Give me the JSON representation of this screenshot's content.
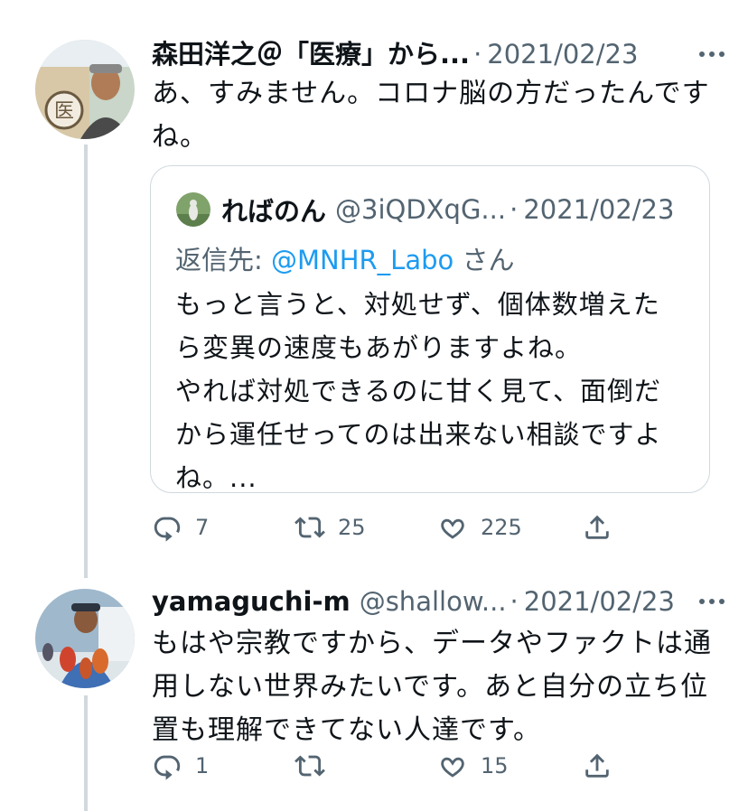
{
  "tweets": [
    {
      "name": "森田洋之＠「医療」から...",
      "separator": "·",
      "date": "2021/02/23",
      "text_lines": [
        "あ、すみません。コロナ脳の方だったんです",
        "ね。"
      ],
      "quote": {
        "name": "ればのん",
        "handle": "@3iQDXqG...",
        "separator": "·",
        "date": "2021/02/23",
        "reply_prefix": "返信先: ",
        "reply_user": "@MNHR_Labo",
        "reply_suffix": " さん",
        "text_lines": [
          "もっと言うと、対処せず、個体数増えた",
          "ら変異の速度もあがりますよね。",
          "やれば対処できるのに甘く見て、面倒だ",
          "から運任せってのは出来ない相談ですよ",
          "ね。..."
        ]
      },
      "actions": {
        "reply_count": "7",
        "retweet_count": "25",
        "like_count": "225"
      }
    },
    {
      "name": "yamaguchi-m",
      "handle": "@shallow...",
      "separator": "·",
      "date": "2021/02/23",
      "text_lines": [
        "もはや宗教ですから、データやファクトは通",
        "用しない世界みたいです。あと自分の立ち位",
        "置も理解できてない人達です。"
      ],
      "actions": {
        "reply_count": "1",
        "retweet_count": "",
        "like_count": "15"
      }
    }
  ],
  "icons": {
    "reply": "reply-icon",
    "retweet": "retweet-icon",
    "like": "heart-icon",
    "share": "share-icon",
    "more": "more-dots-icon"
  },
  "colors": {
    "text": "#0f1419",
    "secondary": "#536471",
    "link": "#1d9bf0",
    "border": "#cfd9de"
  }
}
